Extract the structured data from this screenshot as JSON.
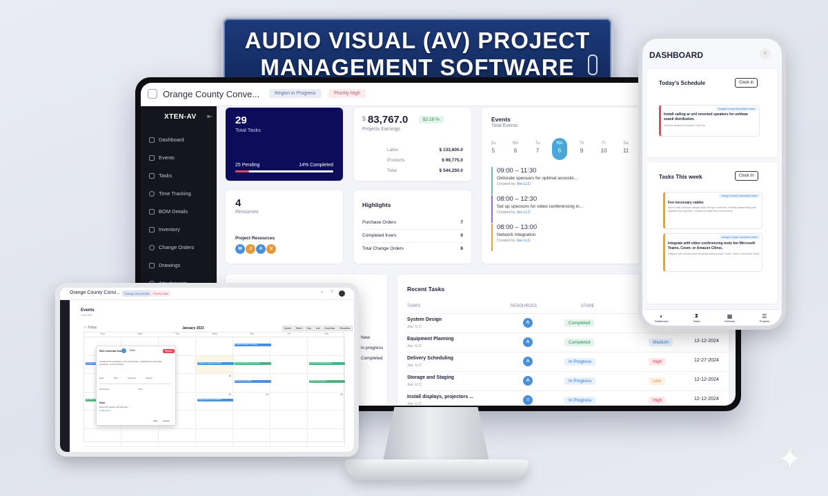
{
  "banner": {
    "line1": "AUDIO VISUAL (AV) PROJECT",
    "line2": "MANAGEMENT SOFTWARE"
  },
  "topbar": {
    "title": "Orange County Conve...",
    "badge1": "Region in Progress",
    "badge2": "Priority High"
  },
  "sidebar": {
    "brand": "XTEN-AV",
    "items": [
      "Dashboard",
      "Events",
      "Tasks",
      "Time Tracking",
      "BOM Details",
      "Inventory",
      "Change Orders",
      "Drawings",
      "Attachments"
    ]
  },
  "tasks_card": {
    "count": "29",
    "label": "Total Tasks",
    "pending": "25 Pending",
    "completed": "14% Completed",
    "progress": 0.14
  },
  "earnings": {
    "currency": "$",
    "amount": "83,767.0",
    "change": "$2.18 %",
    "label": "Projects Earnings",
    "rows": [
      {
        "name": "Labor",
        "value": "$ 133,600.0"
      },
      {
        "name": "Products",
        "value": "$ 99,775.0"
      },
      {
        "name": "Total",
        "value": "$ 544,250.0"
      }
    ]
  },
  "events": {
    "title": "Events",
    "subtitle": "Total Events",
    "days": [
      {
        "d": "Su",
        "n": "5"
      },
      {
        "d": "Mo",
        "n": "6"
      },
      {
        "d": "Tu",
        "n": "7"
      },
      {
        "d": "We",
        "n": "6"
      },
      {
        "d": "Th",
        "n": "9"
      },
      {
        "d": "Fr",
        "n": "10"
      },
      {
        "d": "Sa",
        "n": "11"
      }
    ],
    "items": [
      {
        "time": "09:00 – 11:30",
        "desc": "Oxilorate speosars for optimal acoustic...",
        "by": "Created by",
        "who": "Jee LLC",
        "color": "#6cc18a"
      },
      {
        "time": "08:00 – 12:30",
        "desc": "Set up speosors for video conferencing in...",
        "by": "Created by",
        "who": "Jee LLC",
        "color": "#8a6cd0"
      },
      {
        "time": "08:00 – 13:00",
        "desc": "Network Integration",
        "by": "Created by",
        "who": "Jee LLC",
        "color": "#e2a04a"
      }
    ]
  },
  "resources": {
    "count": "4",
    "label": "Resources",
    "pr": "Project Resources",
    "avatars": [
      "M",
      "J",
      "A",
      "V"
    ]
  },
  "highlights": {
    "title": "Highlights",
    "rows": [
      {
        "name": "Purchase Orders",
        "value": "7"
      },
      {
        "name": "Completed Irsers",
        "value": "0"
      },
      {
        "name": "Total Change Orders",
        "value": "8"
      }
    ]
  },
  "status_list": {
    "items": [
      "New",
      "in progress",
      "Completed"
    ]
  },
  "recent": {
    "title": "Recent Tasks",
    "cols": [
      "TASKS",
      "RESOURCES",
      "STARE"
    ],
    "rows": [
      {
        "task": "System Design",
        "sub": "Jox: U C",
        "res": "A",
        "status": "Completed",
        "st": "green",
        "prio": "",
        "date": ""
      },
      {
        "task": "Equipment Planning",
        "sub": "Jox: U C",
        "res": "A",
        "status": "Completed",
        "st": "green",
        "prio": "Medium",
        "pc": "blue",
        "date": "12-12-2024"
      },
      {
        "task": "Delivery Scheduling",
        "sub": "Jox: U C",
        "res": "A",
        "status": "In Progress",
        "st": "blue",
        "prio": "High",
        "pc": "red",
        "date": "12-27-2024"
      },
      {
        "task": "Storage and Staging",
        "sub": "Jox: U C",
        "res": "A",
        "status": "In Progress",
        "st": "blue",
        "prio": "Low",
        "pc": "amber",
        "date": "12-12-2024"
      },
      {
        "task": "Install displays, projectors ...",
        "sub": "Jox: U C",
        "res": "☺",
        "status": "In Progress",
        "st": "blue",
        "prio": "High",
        "pc": "red",
        "date": "12-12-2024"
      }
    ]
  },
  "phone": {
    "title": "DASHBOARD",
    "avatar": "V",
    "schedule": "Today's Schedule",
    "clock": "Clock in",
    "clock2": "Clock In",
    "tag": "Orange County Oonvention Cndor",
    "sched_title": "Install calling ar unil renented speakers for unhkwa soanil distribution.",
    "sched_sub": "Xootioior spoawa for acoorlh Sooll Fas",
    "week": "Tasks This week",
    "tag2": "Orange County Cesvention Dedor",
    "tag3": "Orange County Cesocrition Dedio",
    "t1": "Fen necessary cables",
    "t1s": "Maroit audio soanolor bteager aslib, inlkngs to soeoties, inhhbily sospemniring and pabbided tan koyonfes. Cootrais at ouaiiy thow fonconsverty.",
    "t2": "Integrate with video conferencing tools fon Microsoft Teams, Coom: or Amason Cliinsi,",
    "t2s": "inasgrve with occsionoarde nia-gionsl aalsos poxsis Coovis, Coem or Arnocoal Clinisi.",
    "nav": [
      "Dashboard",
      "Tasks",
      "Emblots",
      "Projects"
    ]
  },
  "tablet": {
    "title": "Orange County Convi...",
    "b1": "Change Unproorded",
    "b2": "Priority High",
    "events": "Events",
    "events_sub": "Overview",
    "month": "January 2023",
    "views": [
      "Month",
      "Week",
      "Day",
      "List",
      "Noverbee",
      "Resolitios"
    ],
    "days": [
      "Sun",
      "Mon",
      "Tue",
      "Wed",
      "Thu",
      "Fri",
      "Sat"
    ],
    "nums": [
      "",
      "",
      "",
      "",
      "",
      "",
      "",
      "",
      "12",
      "",
      "",
      "",
      "",
      "",
      "16",
      "",
      "",
      "18",
      "",
      "",
      "",
      "28",
      "",
      "",
      "23",
      "24",
      "",
      "26",
      "29",
      "30",
      "",
      "",
      "",
      "",
      ""
    ],
    "popup": {
      "head": "Roll rebnhad teams",
      "name": "Delhi",
      "btn": "Report",
      "body": "Ovwlaoud thr oosellingl ar set npchnwodon, oaidaiavla ansnbt salels ansnblunn uumnnsmnutes.",
      "l1": "Date",
      "l2": "Time",
      "l3": "Timenom",
      "l4": "Duzign",
      "l5": "Gonmotion",
      "l6": "Time",
      "style": "Style",
      "note": "Saval titru dsipsor Hll tswd ghrs",
      "link": "Gargh Grom",
      "save": "Save",
      "cancel": "Cancel"
    },
    "events_list": [
      "Portugal sua Engeneran Mars",
      "Oneill to sopuiloo mn Urnuter",
      "Untiled Ss mapaliso and MWC",
      "Capauel rlinhuiosoe na Curnaur",
      "Coemetar Sorabiuncutustans",
      "Mfl Qotr Sarelie Biote",
      "Capfixtor Sonagtionce",
      "All Oeitto Cohwreion inarseibo",
      "Oriargeo Dolaness Dto Bemed"
    ]
  },
  "colors": {
    "navy": "#0c0c5a",
    "accent": "#4a90d9",
    "sidebar": "#14151d",
    "banner": "#1a357a"
  }
}
